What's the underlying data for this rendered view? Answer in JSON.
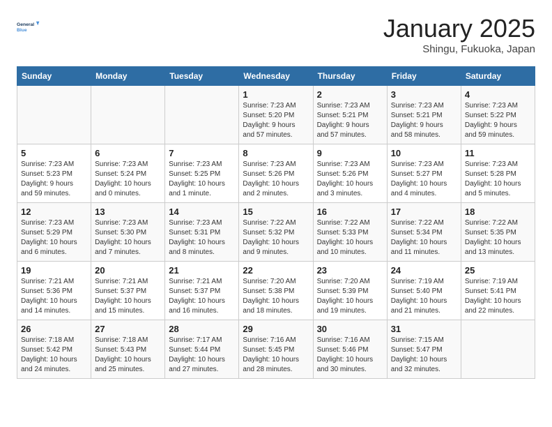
{
  "header": {
    "logo_general": "General",
    "logo_blue": "Blue",
    "month_title": "January 2025",
    "location": "Shingu, Fukuoka, Japan"
  },
  "weekdays": [
    "Sunday",
    "Monday",
    "Tuesday",
    "Wednesday",
    "Thursday",
    "Friday",
    "Saturday"
  ],
  "weeks": [
    [
      {
        "day": "",
        "info": ""
      },
      {
        "day": "",
        "info": ""
      },
      {
        "day": "",
        "info": ""
      },
      {
        "day": "1",
        "info": "Sunrise: 7:23 AM\nSunset: 5:20 PM\nDaylight: 9 hours\nand 57 minutes."
      },
      {
        "day": "2",
        "info": "Sunrise: 7:23 AM\nSunset: 5:21 PM\nDaylight: 9 hours\nand 57 minutes."
      },
      {
        "day": "3",
        "info": "Sunrise: 7:23 AM\nSunset: 5:21 PM\nDaylight: 9 hours\nand 58 minutes."
      },
      {
        "day": "4",
        "info": "Sunrise: 7:23 AM\nSunset: 5:22 PM\nDaylight: 9 hours\nand 59 minutes."
      }
    ],
    [
      {
        "day": "5",
        "info": "Sunrise: 7:23 AM\nSunset: 5:23 PM\nDaylight: 9 hours\nand 59 minutes."
      },
      {
        "day": "6",
        "info": "Sunrise: 7:23 AM\nSunset: 5:24 PM\nDaylight: 10 hours\nand 0 minutes."
      },
      {
        "day": "7",
        "info": "Sunrise: 7:23 AM\nSunset: 5:25 PM\nDaylight: 10 hours\nand 1 minute."
      },
      {
        "day": "8",
        "info": "Sunrise: 7:23 AM\nSunset: 5:26 PM\nDaylight: 10 hours\nand 2 minutes."
      },
      {
        "day": "9",
        "info": "Sunrise: 7:23 AM\nSunset: 5:26 PM\nDaylight: 10 hours\nand 3 minutes."
      },
      {
        "day": "10",
        "info": "Sunrise: 7:23 AM\nSunset: 5:27 PM\nDaylight: 10 hours\nand 4 minutes."
      },
      {
        "day": "11",
        "info": "Sunrise: 7:23 AM\nSunset: 5:28 PM\nDaylight: 10 hours\nand 5 minutes."
      }
    ],
    [
      {
        "day": "12",
        "info": "Sunrise: 7:23 AM\nSunset: 5:29 PM\nDaylight: 10 hours\nand 6 minutes."
      },
      {
        "day": "13",
        "info": "Sunrise: 7:23 AM\nSunset: 5:30 PM\nDaylight: 10 hours\nand 7 minutes."
      },
      {
        "day": "14",
        "info": "Sunrise: 7:23 AM\nSunset: 5:31 PM\nDaylight: 10 hours\nand 8 minutes."
      },
      {
        "day": "15",
        "info": "Sunrise: 7:22 AM\nSunset: 5:32 PM\nDaylight: 10 hours\nand 9 minutes."
      },
      {
        "day": "16",
        "info": "Sunrise: 7:22 AM\nSunset: 5:33 PM\nDaylight: 10 hours\nand 10 minutes."
      },
      {
        "day": "17",
        "info": "Sunrise: 7:22 AM\nSunset: 5:34 PM\nDaylight: 10 hours\nand 11 minutes."
      },
      {
        "day": "18",
        "info": "Sunrise: 7:22 AM\nSunset: 5:35 PM\nDaylight: 10 hours\nand 13 minutes."
      }
    ],
    [
      {
        "day": "19",
        "info": "Sunrise: 7:21 AM\nSunset: 5:36 PM\nDaylight: 10 hours\nand 14 minutes."
      },
      {
        "day": "20",
        "info": "Sunrise: 7:21 AM\nSunset: 5:37 PM\nDaylight: 10 hours\nand 15 minutes."
      },
      {
        "day": "21",
        "info": "Sunrise: 7:21 AM\nSunset: 5:37 PM\nDaylight: 10 hours\nand 16 minutes."
      },
      {
        "day": "22",
        "info": "Sunrise: 7:20 AM\nSunset: 5:38 PM\nDaylight: 10 hours\nand 18 minutes."
      },
      {
        "day": "23",
        "info": "Sunrise: 7:20 AM\nSunset: 5:39 PM\nDaylight: 10 hours\nand 19 minutes."
      },
      {
        "day": "24",
        "info": "Sunrise: 7:19 AM\nSunset: 5:40 PM\nDaylight: 10 hours\nand 21 minutes."
      },
      {
        "day": "25",
        "info": "Sunrise: 7:19 AM\nSunset: 5:41 PM\nDaylight: 10 hours\nand 22 minutes."
      }
    ],
    [
      {
        "day": "26",
        "info": "Sunrise: 7:18 AM\nSunset: 5:42 PM\nDaylight: 10 hours\nand 24 minutes."
      },
      {
        "day": "27",
        "info": "Sunrise: 7:18 AM\nSunset: 5:43 PM\nDaylight: 10 hours\nand 25 minutes."
      },
      {
        "day": "28",
        "info": "Sunrise: 7:17 AM\nSunset: 5:44 PM\nDaylight: 10 hours\nand 27 minutes."
      },
      {
        "day": "29",
        "info": "Sunrise: 7:16 AM\nSunset: 5:45 PM\nDaylight: 10 hours\nand 28 minutes."
      },
      {
        "day": "30",
        "info": "Sunrise: 7:16 AM\nSunset: 5:46 PM\nDaylight: 10 hours\nand 30 minutes."
      },
      {
        "day": "31",
        "info": "Sunrise: 7:15 AM\nSunset: 5:47 PM\nDaylight: 10 hours\nand 32 minutes."
      },
      {
        "day": "",
        "info": ""
      }
    ]
  ]
}
